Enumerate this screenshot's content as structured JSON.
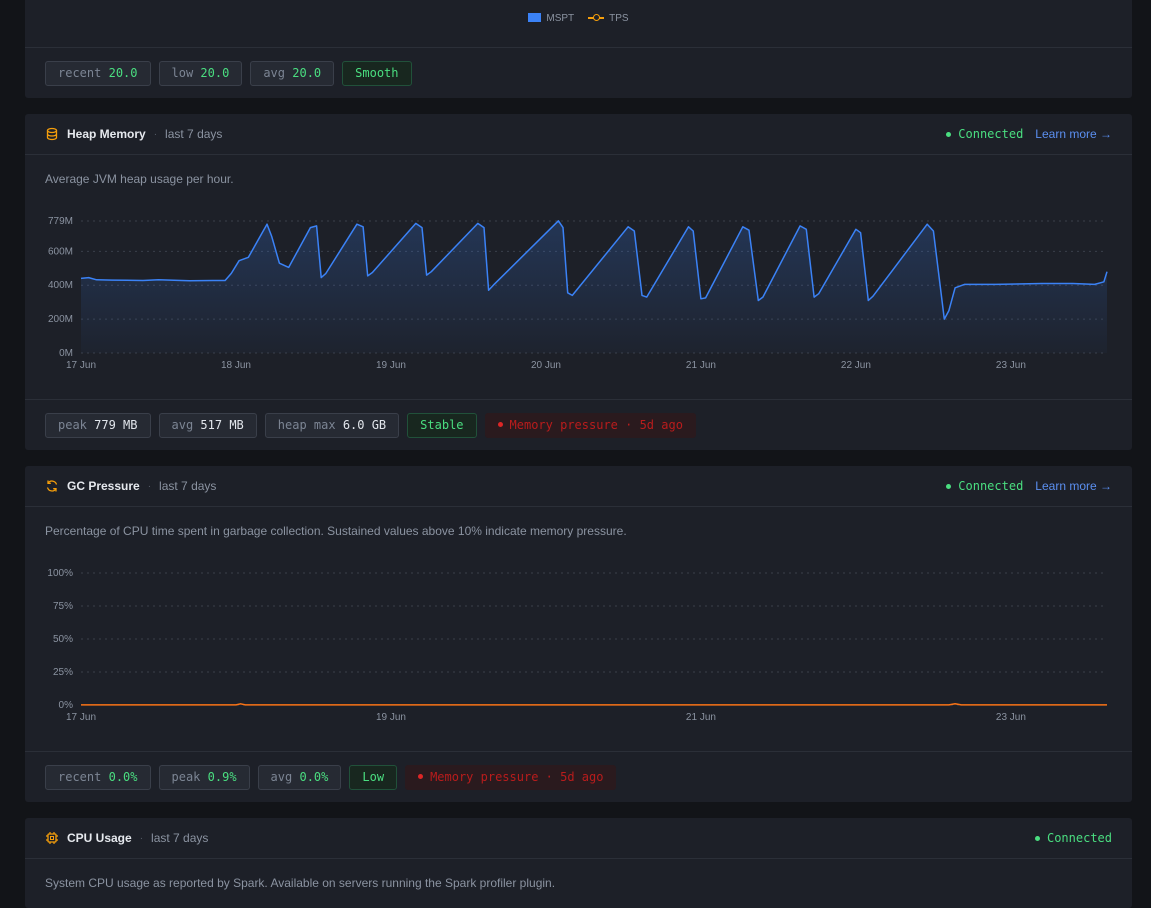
{
  "tps_card": {
    "legend": [
      {
        "label": "MSPT",
        "color": "#3b82f6"
      },
      {
        "label": "TPS",
        "color": "#f59e0b"
      }
    ],
    "chips": {
      "recent_label": "recent",
      "recent_value": "20.0",
      "low_label": "low",
      "low_value": "20.0",
      "avg_label": "avg",
      "avg_value": "20.0",
      "badge": "Smooth"
    }
  },
  "heap_card": {
    "title": "Heap Memory",
    "range": "last 7 days",
    "status": "Connected",
    "learn_more": "Learn more →",
    "description": "Average JVM heap usage per hour.",
    "chips": {
      "peak_label": "peak",
      "peak_value": "779 MB",
      "avg_label": "avg",
      "avg_value": "517 MB",
      "heapmax_label": "heap max",
      "heapmax_value": "6.0 GB",
      "badge": "Stable",
      "alert": "Memory pressure · 5d ago"
    },
    "chart_data": {
      "type": "area",
      "ylabel": "",
      "ylim": [
        0,
        779
      ],
      "y_ticks": [
        "0M",
        "200M",
        "400M",
        "600M",
        "779M"
      ],
      "y_tick_values": [
        0,
        200,
        400,
        600,
        779
      ],
      "y_tick_labels_shown": [
        "0M",
        "200M",
        "400M",
        "600M",
        "779M"
      ],
      "x_ticks": [
        "17 Jun",
        "18 Jun",
        "19 Jun",
        "20 Jun",
        "21 Jun",
        "22 Jun",
        "23 Jun"
      ],
      "x_range_days": [
        0,
        6.62
      ],
      "series": [
        {
          "color": "#3b82f6",
          "points": [
            [
              0.0,
              440
            ],
            [
              0.05,
              445
            ],
            [
              0.1,
              432
            ],
            [
              0.2,
              430
            ],
            [
              0.4,
              428
            ],
            [
              0.5,
              432
            ],
            [
              0.7,
              426
            ],
            [
              0.85,
              428
            ],
            [
              0.93,
              428
            ],
            [
              0.97,
              470
            ],
            [
              1.02,
              545
            ],
            [
              1.08,
              565
            ],
            [
              1.2,
              760
            ],
            [
              1.23,
              690
            ],
            [
              1.28,
              530
            ],
            [
              1.34,
              505
            ],
            [
              1.48,
              740
            ],
            [
              1.52,
              750
            ],
            [
              1.55,
              445
            ],
            [
              1.58,
              470
            ],
            [
              1.78,
              760
            ],
            [
              1.82,
              745
            ],
            [
              1.85,
              455
            ],
            [
              1.88,
              475
            ],
            [
              2.16,
              765
            ],
            [
              2.2,
              740
            ],
            [
              2.23,
              460
            ],
            [
              2.26,
              480
            ],
            [
              2.56,
              765
            ],
            [
              2.6,
              740
            ],
            [
              2.63,
              370
            ],
            [
              2.66,
              400
            ],
            [
              3.08,
              780
            ],
            [
              3.11,
              740
            ],
            [
              3.14,
              355
            ],
            [
              3.17,
              340
            ],
            [
              3.53,
              745
            ],
            [
              3.57,
              720
            ],
            [
              3.62,
              340
            ],
            [
              3.65,
              330
            ],
            [
              3.92,
              745
            ],
            [
              3.95,
              720
            ],
            [
              4.0,
              320
            ],
            [
              4.03,
              325
            ],
            [
              4.27,
              745
            ],
            [
              4.31,
              725
            ],
            [
              4.37,
              310
            ],
            [
              4.4,
              330
            ],
            [
              4.64,
              750
            ],
            [
              4.68,
              730
            ],
            [
              4.73,
              330
            ],
            [
              4.76,
              350
            ],
            [
              5.0,
              730
            ],
            [
              5.03,
              710
            ],
            [
              5.08,
              310
            ],
            [
              5.11,
              335
            ],
            [
              5.46,
              760
            ],
            [
              5.5,
              720
            ],
            [
              5.57,
              200
            ],
            [
              5.6,
              250
            ],
            [
              5.64,
              385
            ],
            [
              5.7,
              405
            ],
            [
              5.9,
              405
            ],
            [
              6.2,
              410
            ],
            [
              6.4,
              410
            ],
            [
              6.54,
              405
            ],
            [
              6.58,
              415
            ],
            [
              6.6,
              420
            ],
            [
              6.62,
              480
            ]
          ]
        }
      ]
    }
  },
  "gc_card": {
    "title": "GC Pressure",
    "range": "last 7 days",
    "status": "Connected",
    "learn_more": "Learn more →",
    "description": "Percentage of CPU time spent in garbage collection. Sustained values above 10% indicate memory pressure.",
    "chips": {
      "recent_label": "recent",
      "recent_value": "0.0%",
      "peak_label": "peak",
      "peak_value": "0.9%",
      "avg_label": "avg",
      "avg_value": "0.0%",
      "badge": "Low",
      "alert": "Memory pressure · 5d ago"
    },
    "chart_data": {
      "type": "line",
      "ylim": [
        0,
        100
      ],
      "y_ticks": [
        "0%",
        "25%",
        "50%",
        "75%",
        "100%"
      ],
      "y_tick_values": [
        0,
        25,
        50,
        75,
        100
      ],
      "x_ticks": [
        "17 Jun",
        "19 Jun",
        "21 Jun",
        "23 Jun"
      ],
      "x_tick_days": [
        0,
        2,
        4,
        6
      ],
      "x_range_days": [
        0,
        6.62
      ],
      "series": [
        {
          "color": "#f97316",
          "points": [
            [
              0,
              0.1
            ],
            [
              1.0,
              0.1
            ],
            [
              1.03,
              0.9
            ],
            [
              1.06,
              0.1
            ],
            [
              3.0,
              0.1
            ],
            [
              5.6,
              0.1
            ],
            [
              5.64,
              0.9
            ],
            [
              5.68,
              0.1
            ],
            [
              6.62,
              0.1
            ]
          ]
        }
      ]
    }
  },
  "cpu_card": {
    "title": "CPU Usage",
    "range": "last 7 days",
    "status": "Connected",
    "description": "System CPU usage as reported by Spark. Available on servers running the Spark profiler plugin."
  }
}
